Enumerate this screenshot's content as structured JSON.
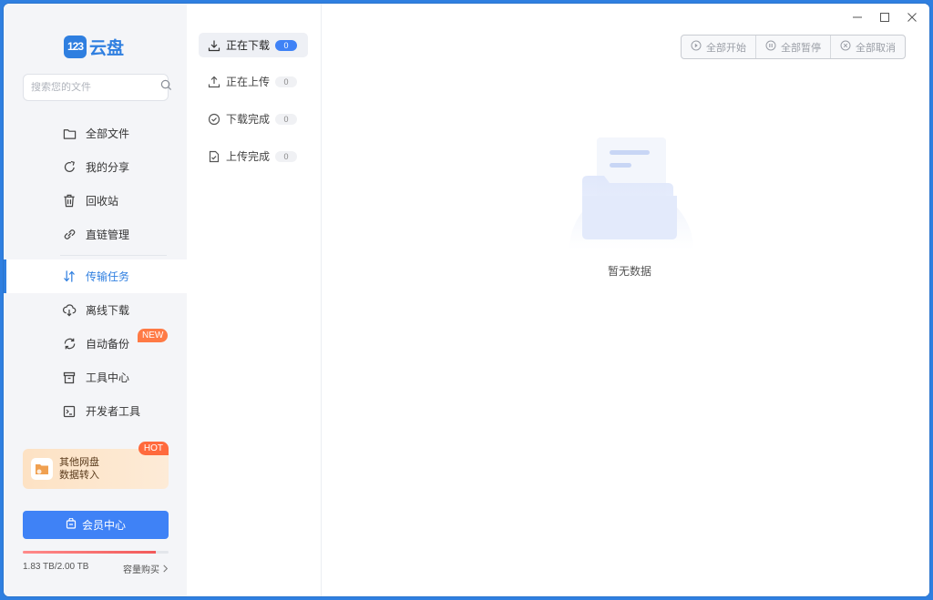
{
  "app": {
    "logo_badge": "123",
    "logo_text": "云盘"
  },
  "search": {
    "placeholder": "搜索您的文件"
  },
  "nav": {
    "all_files": "全部文件",
    "my_share": "我的分享",
    "recycle": "回收站",
    "direct_link": "直链管理",
    "transfer": "传输任务",
    "offline": "离线下载",
    "backup": "自动备份",
    "backup_badge": "NEW",
    "tools": "工具中心",
    "developer": "开发者工具"
  },
  "promo": {
    "line1": "其他网盘",
    "line2": "数据转入",
    "badge": "HOT"
  },
  "vip": {
    "label": "会员中心"
  },
  "storage": {
    "used": "1.83 TB/2.00 TB",
    "used_fraction": 0.915,
    "buy": "容量购买"
  },
  "transfer_tabs": [
    {
      "label": "正在下载",
      "count": "0"
    },
    {
      "label": "正在上传",
      "count": "0"
    },
    {
      "label": "下载完成",
      "count": "0"
    },
    {
      "label": "上传完成",
      "count": "0"
    }
  ],
  "actions": {
    "start_all": "全部开始",
    "pause_all": "全部暂停",
    "cancel_all": "全部取消"
  },
  "empty": {
    "text": "暂无数据"
  },
  "colors": {
    "accent": "#3f82f6",
    "new_badge": "#ff7a45",
    "hot_badge": "#ff6a3d"
  }
}
